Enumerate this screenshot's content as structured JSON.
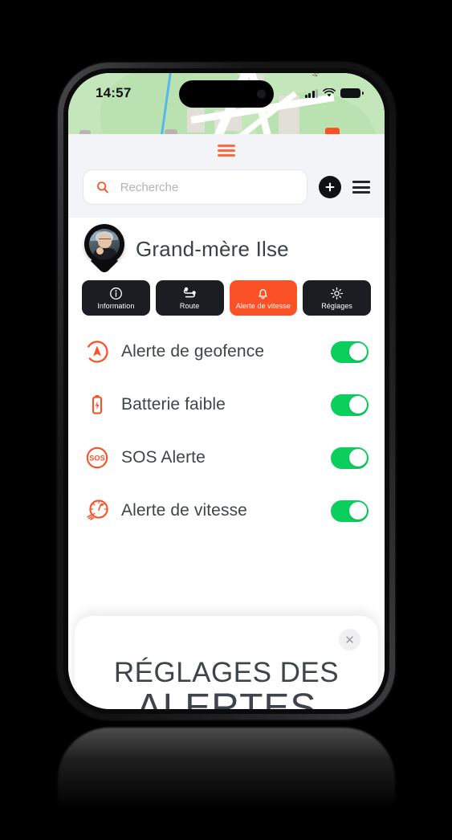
{
  "status_bar": {
    "time": "14:57",
    "signal_icon": "cellular-signal-icon",
    "wifi_icon": "wifi-icon",
    "battery_icon": "battery-icon"
  },
  "map": {
    "street_label": "Wa"
  },
  "panel": {
    "drag_handle_icon": "drag-handle-icon"
  },
  "search": {
    "placeholder": "Recherche",
    "value": "",
    "search_icon": "search-icon",
    "add_label": "+",
    "add_icon": "plus-icon",
    "menu_icon": "hamburger-menu-icon"
  },
  "profile": {
    "name": "Grand-mère Ilse",
    "avatar_icon": "map-pin-avatar"
  },
  "actions": [
    {
      "label": "Information",
      "icon": "info-circle-icon",
      "accent": false
    },
    {
      "label": "Route",
      "icon": "route-icon",
      "accent": false
    },
    {
      "label": "Alerte de vitesse",
      "icon": "bell-icon",
      "accent": true
    },
    {
      "label": "Réglages",
      "icon": "gear-icon",
      "accent": false
    }
  ],
  "alerts": [
    {
      "label": "Alerte de geofence",
      "icon": "geofence-navigation-icon",
      "enabled": true
    },
    {
      "label": "Batterie faible",
      "icon": "low-battery-icon",
      "enabled": true
    },
    {
      "label": "SOS Alerte",
      "icon": "sos-icon",
      "enabled": true
    },
    {
      "label": "Alerte de vitesse",
      "icon": "speedometer-icon",
      "enabled": true
    }
  ],
  "overlay": {
    "title_line1": "RÉGLAGES DES",
    "title_line2": "ALERTES",
    "close_label": "✕",
    "close_icon": "close-icon"
  },
  "colors": {
    "accent_orange": "#fa5226",
    "toggle_green": "#0ACF5C",
    "dark": "#1c1d22",
    "panel_grey": "#f2f4f8",
    "text": "#3f444b"
  }
}
